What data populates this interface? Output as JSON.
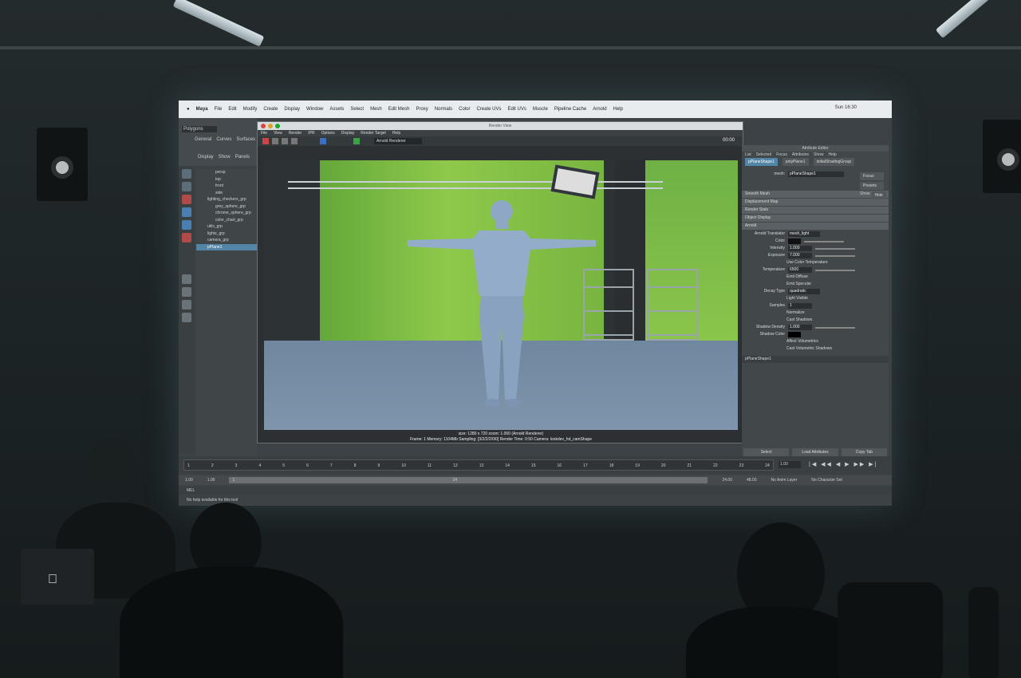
{
  "menubar": {
    "app": "Maya",
    "items": [
      "File",
      "Edit",
      "Modify",
      "Create",
      "Display",
      "Window",
      "Assets",
      "Select",
      "Mesh",
      "Edit Mesh",
      "Proxy",
      "Normals",
      "Color",
      "Create UVs",
      "Edit UVs",
      "Muscle",
      "Pipeline Cache",
      "Arnold",
      "Help"
    ],
    "status": "Sun 16:30"
  },
  "shelf": {
    "mode": "Polygons",
    "tabs": [
      "General",
      "Curves",
      "Surfaces"
    ],
    "panel_menu": [
      "Display",
      "Show",
      "Panels"
    ]
  },
  "outliner": {
    "items": [
      "persp",
      "top",
      "front",
      "side",
      "lighting_checkers_grp",
      "grey_sphere_grp",
      "chrome_sphere_grp",
      "color_chart_grp",
      "utils_grp",
      "lights_grp",
      "camera_grp",
      "pPlane1"
    ],
    "selected": "pPlane1"
  },
  "render_view": {
    "title": "Render View",
    "menu": [
      "File",
      "View",
      "Render",
      "IPR",
      "Options",
      "Display",
      "Render Target",
      "Help"
    ],
    "renderer": "Arnold Renderer",
    "time": "00:00",
    "status_line1": "size: 1280 x 720 zoom: 1.000    (Arnold Renderer)",
    "status_line2": "Frame: 1    Memory: 1104Mb    Sampling: [3/2/2/2/0/0]    Render Time: 0:50    Camera: lookdev_hd_camShape"
  },
  "attribute_editor": {
    "title": "Attribute Editor",
    "menu": [
      "List",
      "Selected",
      "Focus",
      "Attributes",
      "Show",
      "Help"
    ],
    "tabs": [
      "pPlaneShape1",
      "polyPlane1",
      "initialShadingGroup"
    ],
    "mesh_label": "mesh:",
    "mesh_value": "pPlaneShape1",
    "buttons": [
      "Focus",
      "Presets",
      "Show",
      "Hide"
    ],
    "sections": [
      "Smooth Mesh",
      "Displacement Map",
      "Render Stats",
      "Object Display",
      "Arnold"
    ],
    "translator_label": "Arnold Translator",
    "translator_value": "mesh_light",
    "color_label": "Color",
    "intensity_label": "Intensity",
    "intensity_value": "1.000",
    "exposure_label": "Exposure",
    "exposure_value": "7.000",
    "use_color_temp": "Use Color Temperature",
    "temperature_label": "Temperature",
    "temperature_value": "6500",
    "emit_diffuse": "Emit Diffuse",
    "emit_specular": "Emit Specular",
    "decay_label": "Decay Type",
    "decay_value": "quadratic",
    "light_visible": "Light Visible",
    "samples_label": "Samples",
    "samples_value": "1",
    "normalize": "Normalize",
    "cast_shadows": "Cast Shadows",
    "shadow_density_label": "Shadow Density",
    "shadow_density_value": "1.000",
    "shadow_color_label": "Shadow Color",
    "affect_volumetrics": "Affect Volumetrics",
    "cast_vol_shadows": "Cast Volumetric Shadows",
    "footer_name": "pPlaneShape1",
    "select_btn": "Select",
    "load_btn": "Load Attributes",
    "copy_btn": "Copy Tab"
  },
  "timeline": {
    "current": "1.00",
    "ticks": [
      "1",
      "2",
      "3",
      "4",
      "5",
      "6",
      "7",
      "8",
      "9",
      "10",
      "11",
      "12",
      "13",
      "14",
      "15",
      "16",
      "17",
      "18",
      "19",
      "20",
      "21",
      "22",
      "23",
      "24"
    ]
  },
  "range": {
    "start": "1.00",
    "start2": "1.00",
    "range_start": "1",
    "range_end": "24",
    "end": "24.00",
    "end2": "48.00",
    "anim_layer": "No Anim Layer",
    "char_set": "No Character Set"
  },
  "cmdline": {
    "label": "MEL"
  },
  "helpline": {
    "text": "No help available for this tool"
  },
  "colors": {
    "green": "#8ec94b",
    "maya_bg": "#444a4d",
    "select_blue": "#5285a6"
  }
}
